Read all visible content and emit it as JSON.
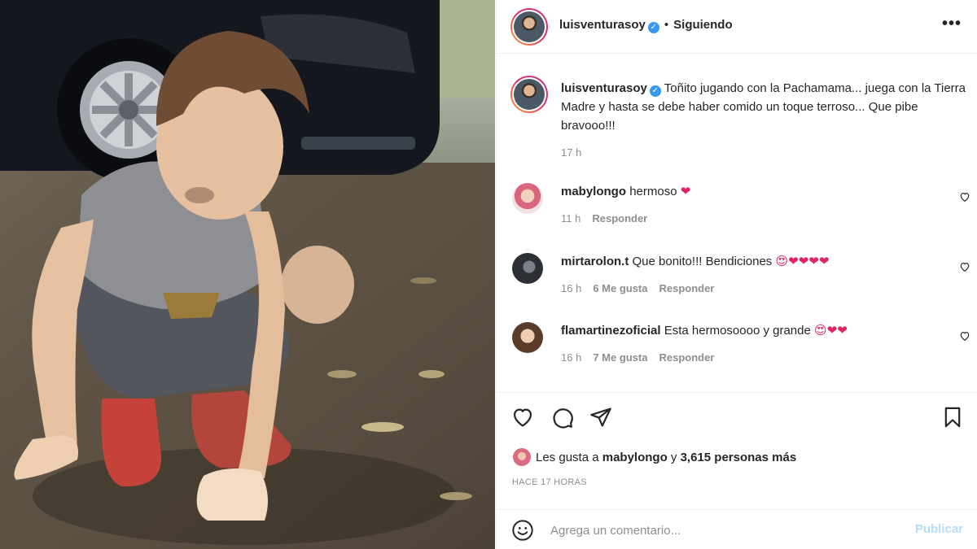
{
  "post": {
    "username": "luisventurasoy",
    "follow_status": "Siguiendo",
    "more_label": "•••"
  },
  "caption": {
    "username": "luisventurasoy",
    "text": "Toñito jugando con la Pachamama... juega con la Tierra Madre y hasta se debe haber comido un toque terroso... Que pibe bravooo!!!",
    "time": "17 h"
  },
  "comments": [
    {
      "username": "mabylongo",
      "text": "hermoso",
      "emoji": "❤",
      "time": "11 h",
      "likes": "",
      "reply": "Responder"
    },
    {
      "username": "mirtarolon.t",
      "text": "Que bonito!!! Bendiciones",
      "emoji": "😍❤❤❤❤",
      "time": "16 h",
      "likes": "6 Me gusta",
      "reply": "Responder"
    },
    {
      "username": "flamartinezoficial",
      "text": "Esta hermosoooo y grande",
      "emoji": "😍❤❤",
      "time": "16 h",
      "likes": "7 Me gusta",
      "reply": "Responder"
    }
  ],
  "likes_summary": {
    "prefix": "Les gusta a",
    "user": "mabylongo",
    "joiner": "y",
    "others": "3,615 personas más"
  },
  "timestamp": "HACE 17 HORAS",
  "add_comment": {
    "placeholder": "Agrega un comentario...",
    "publish_label": "Publicar"
  },
  "icons": {
    "like": "heart-icon",
    "comment": "comment-bubble-icon",
    "share": "paper-plane-icon",
    "save": "bookmark-icon",
    "emoji": "smiley-icon"
  },
  "colors": {
    "verified": "#3897f0",
    "publish_disabled": "#b2dffc",
    "heart": "#e0245e"
  }
}
